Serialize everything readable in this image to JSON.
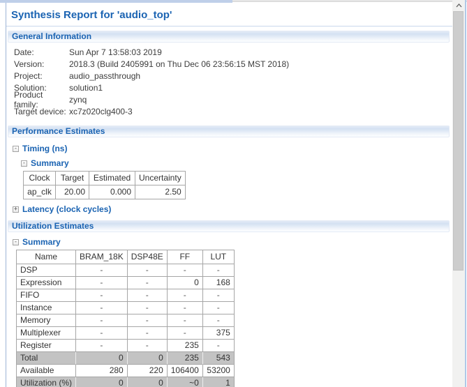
{
  "title": "Synthesis Report for 'audio_top'",
  "icons": {
    "collapse": "-",
    "expand": "+"
  },
  "general_information": {
    "header": "General Information",
    "fields": [
      {
        "label": "Date:",
        "value": "Sun Apr 7 13:58:03 2019"
      },
      {
        "label": "Version:",
        "value": "2018.3 (Build 2405991 on Thu Dec 06 23:56:15 MST 2018)"
      },
      {
        "label": "Project:",
        "value": "audio_passthrough"
      },
      {
        "label": "Solution:",
        "value": "solution1"
      },
      {
        "label": "Product family:",
        "value": "zynq"
      },
      {
        "label": "Target device:",
        "value": "xc7z020clg400-3"
      }
    ]
  },
  "performance_estimates": {
    "header": "Performance Estimates",
    "timing_label": "Timing (ns)",
    "timing_summary_label": "Summary",
    "latency_label": "Latency (clock cycles)",
    "timing_table": {
      "headers": [
        "Clock",
        "Target",
        "Estimated",
        "Uncertainty"
      ],
      "rows": [
        [
          "ap_clk",
          "20.00",
          "0.000",
          "2.50"
        ]
      ]
    }
  },
  "utilization_estimates": {
    "header": "Utilization Estimates",
    "summary_label": "Summary",
    "table": {
      "headers": [
        "Name",
        "BRAM_18K",
        "DSP48E",
        "FF",
        "LUT"
      ],
      "rows": [
        [
          "DSP",
          "-",
          "-",
          "-",
          "-"
        ],
        [
          "Expression",
          "-",
          "-",
          "0",
          "168"
        ],
        [
          "FIFO",
          "-",
          "-",
          "-",
          "-"
        ],
        [
          "Instance",
          "-",
          "-",
          "-",
          "-"
        ],
        [
          "Memory",
          "-",
          "-",
          "-",
          "-"
        ],
        [
          "Multiplexer",
          "-",
          "-",
          "-",
          "375"
        ],
        [
          "Register",
          "-",
          "-",
          "235",
          "-"
        ],
        [
          "Total",
          "0",
          "0",
          "235",
          "543"
        ],
        [
          "Available",
          "280",
          "220",
          "106400",
          "53200"
        ],
        [
          "Utilization (%)",
          "0",
          "0",
          "~0",
          "1"
        ]
      ]
    }
  }
}
